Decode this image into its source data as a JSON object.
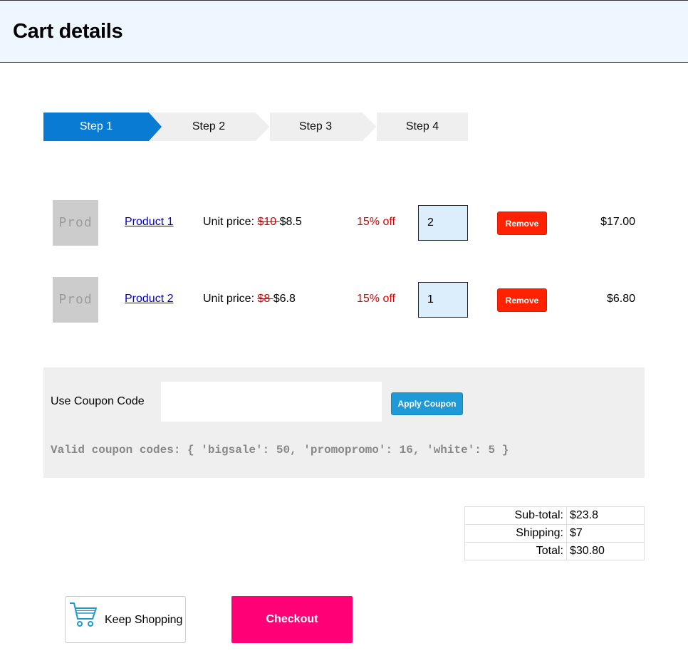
{
  "header": {
    "title": "Cart details"
  },
  "steps": [
    {
      "label": "Step 1",
      "active": true
    },
    {
      "label": "Step 2",
      "active": false
    },
    {
      "label": "Step 3",
      "active": false
    },
    {
      "label": "Step 4",
      "active": false
    }
  ],
  "colors": {
    "active_step": "#0a7bd3",
    "remove": "#ff2200",
    "apply": "#1e9bd7",
    "checkout": "#ff0077",
    "discount": "#e00000"
  },
  "cart": {
    "items": [
      {
        "thumb": "Prod",
        "name": "Product 1",
        "unit_price_label": "Unit price: ",
        "old_price": "$10 ",
        "new_price": "$8.5",
        "discount": "15% off",
        "quantity": "2",
        "remove_label": "Remove",
        "total": "$17.00"
      },
      {
        "thumb": "Prod",
        "name": "Product 2",
        "unit_price_label": "Unit price: ",
        "old_price": "$8 ",
        "new_price": "$6.8",
        "discount": "15% off",
        "quantity": "1",
        "remove_label": "Remove",
        "total": "$6.80"
      }
    ]
  },
  "coupon": {
    "label": "Use Coupon Code",
    "value": "",
    "apply_label": "Apply Coupon",
    "valid_codes_text": "Valid coupon codes: { 'bigsale': 50, 'promopromo': 16, 'white': 5 }"
  },
  "totals": {
    "subtotal_label": "Sub-total:",
    "subtotal": "$23.8",
    "shipping_label": "Shipping:",
    "shipping": "$7",
    "total_label": "Total:",
    "total": "$30.80"
  },
  "actions": {
    "keep_shopping_label": "Keep Shopping",
    "keep_shopping_icon": "shopping-cart-icon",
    "checkout_label": "Checkout"
  }
}
